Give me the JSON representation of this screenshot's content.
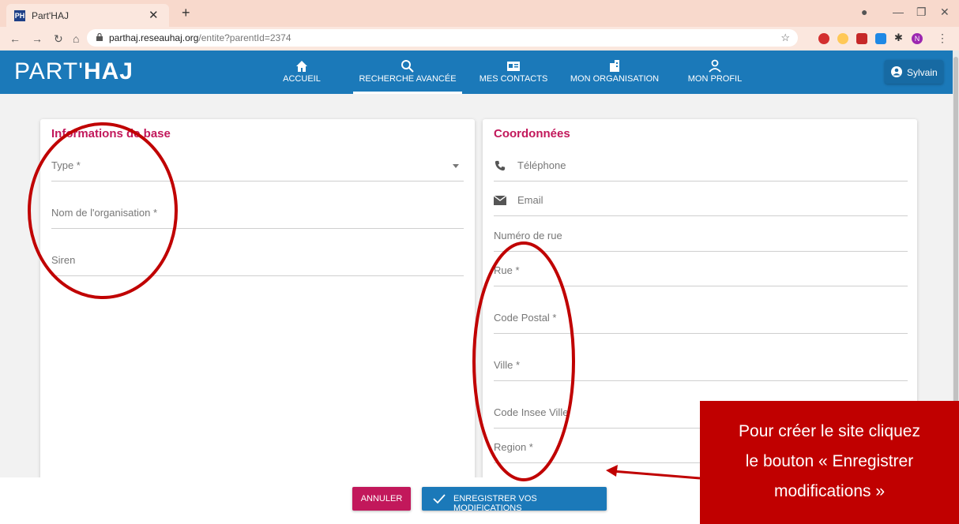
{
  "browser": {
    "tab_title": "Part'HAJ",
    "tab_favicon": "PH",
    "url_domain": "parthaj.reseauhaj.org",
    "url_path": "/entite?parentId=2374",
    "profile_initial": "N"
  },
  "header": {
    "logo_left": "PART'",
    "logo_right": "HAJ",
    "nav": [
      {
        "label": "ACCUEIL",
        "icon": "home-icon"
      },
      {
        "label": "RECHERCHE AVANCÉE",
        "icon": "search-icon"
      },
      {
        "label": "MES CONTACTS",
        "icon": "contact-card-icon"
      },
      {
        "label": "MON ORGANISATION",
        "icon": "building-icon"
      },
      {
        "label": "MON PROFIL",
        "icon": "person-icon"
      }
    ],
    "active_nav": "RECHERCHE AVANCÉE",
    "user_name": "Sylvain"
  },
  "basic_info": {
    "title": "Informations de base",
    "fields": [
      "Type *",
      "Nom de l'organisation *",
      "Siren"
    ]
  },
  "contact": {
    "title": "Coordonnées",
    "fields": [
      "Téléphone",
      "Email",
      "Numéro de rue",
      "Rue *",
      "Code Postal *",
      "Ville *",
      "Code Insee Ville",
      "Region *"
    ]
  },
  "actions": {
    "cancel": "ANNULER",
    "save": "ENREGISTRER VOS MODIFICATIONS"
  },
  "callout": {
    "line1": "Pour créer le site cliquez",
    "line2": "le bouton « Enregistrer",
    "line3": "modifications »"
  },
  "colors": {
    "brand_blue": "#1b79b9",
    "accent_pink": "#c2185b",
    "annotation_red": "#c00000"
  }
}
